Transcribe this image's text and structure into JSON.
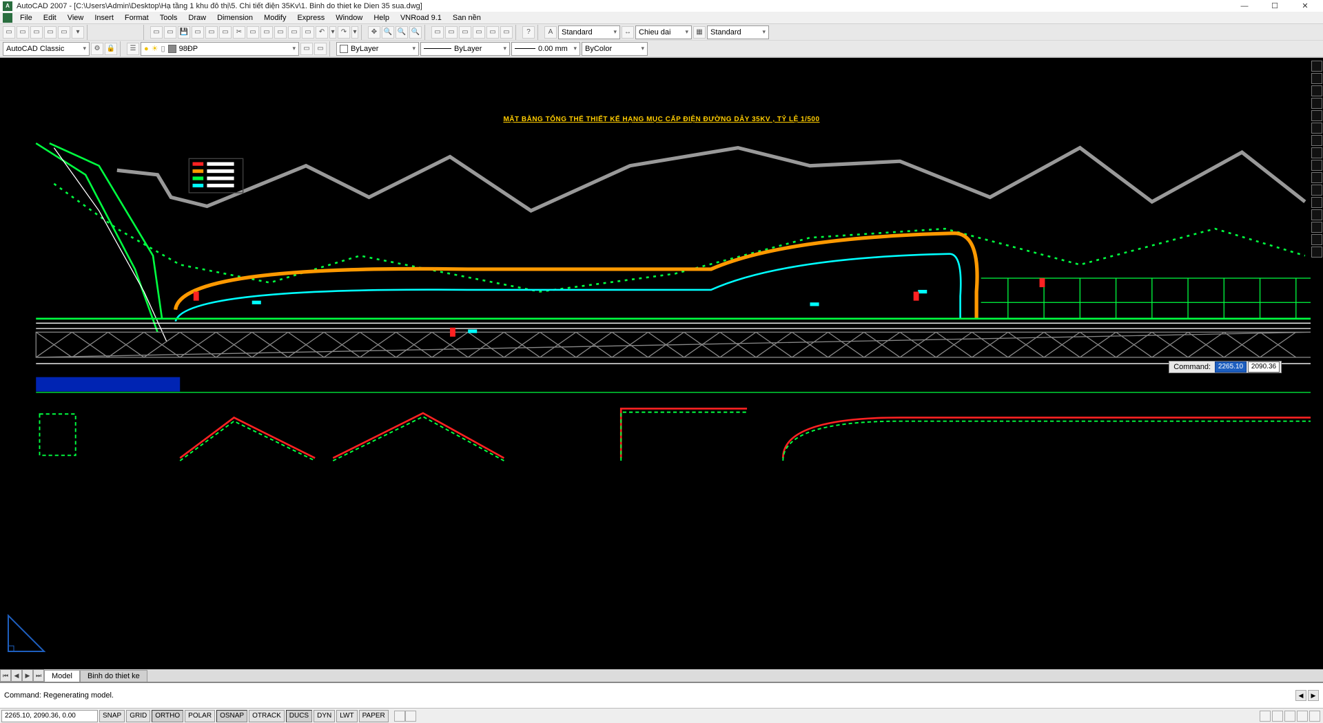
{
  "title": "AutoCAD 2007 - [C:\\Users\\Admin\\Desktop\\Hạ tầng 1 khu đô thị\\5. Chi tiết điện 35Kv\\1. Binh do thiet ke Dien 35 sua.dwg]",
  "menu": [
    "File",
    "Edit",
    "View",
    "Insert",
    "Format",
    "Tools",
    "Draw",
    "Dimension",
    "Modify",
    "Express",
    "Window",
    "Help",
    "VNRoad 9.1",
    "San nền"
  ],
  "workspace": "AutoCAD Classic",
  "layer_combo": "98ĐP",
  "style1": "Standard",
  "dim1": "Chieu dai",
  "style2": "Standard",
  "layer_dd": "ByLayer",
  "ltype_dd": "ByLayer",
  "lweight_dd": "0.00 mm",
  "plot_dd": "ByColor",
  "tabs": {
    "model": "Model",
    "layout": "Binh do thiet ke"
  },
  "cmdline": "Command: Regenerating model.",
  "coords": "2265.10, 2090.36, 0.00",
  "status_btns": [
    "SNAP",
    "GRID",
    "ORTHO",
    "POLAR",
    "OSNAP",
    "OTRACK",
    "DUCS",
    "DYN",
    "LWT",
    "PAPER"
  ],
  "drawing_title": "MẶT BẰNG TỔNG THỂ THIẾT KẾ HẠNG MỤC CẤP ĐIỆN ĐƯỜNG DÂY 35KV , TỶ LỆ 1/500",
  "cmd_float": {
    "label": "Command:",
    "v1": "2265.10",
    "v2": "2090.36"
  }
}
